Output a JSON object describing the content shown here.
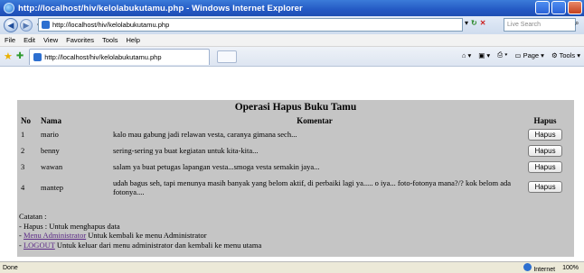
{
  "window": {
    "title": "http://localhost/hiv/kelolabukutamu.php - Windows Internet Explorer"
  },
  "address_bar": {
    "url": "http://localhost/hiv/kelolabukutamu.php",
    "search_placeholder": "Live Search"
  },
  "menu": [
    "File",
    "Edit",
    "View",
    "Favorites",
    "Tools",
    "Help"
  ],
  "tab": {
    "label": "http://localhost/hiv/kelolabukutamu.php"
  },
  "command_bar": {
    "page": "Page",
    "tools": "Tools"
  },
  "page": {
    "title": "Operasi Hapus Buku Tamu",
    "columns": {
      "no": "No",
      "nama": "Nama",
      "komentar": "Komentar",
      "hapus": "Hapus"
    },
    "rows": [
      {
        "no": "1",
        "nama": "mario",
        "komentar": "kalo mau gabung jadi relawan vesta, caranya gimana sech...",
        "action": "Hapus"
      },
      {
        "no": "2",
        "nama": "benny",
        "komentar": "sering-sering ya buat kegiatan untuk kita-kita...",
        "action": "Hapus"
      },
      {
        "no": "3",
        "nama": "wawan",
        "komentar": "salam ya buat petugas lapangan vesta...smoga vesta semakin jaya...",
        "action": "Hapus"
      },
      {
        "no": "4",
        "nama": "mantep",
        "komentar": "udah bagus seh, tapi menunya masih banyak yang belom aktif, di perbaiki lagi ya..... o iya... foto-fotonya mana?/? kok belom ada fotonya....",
        "action": "Hapus"
      }
    ],
    "notes": {
      "heading": "Catatan :",
      "hapus_line": "- Hapus : Untuk menghapus data",
      "menu_prefix": "- ",
      "menu_link": "Menu Administrator",
      "menu_text": " Untuk kembali ke menu Administrator",
      "logout_prefix": "- ",
      "logout_link": "LOGOUT",
      "logout_text": " Untuk keluar dari menu administrator dan kembali ke menu utama"
    }
  },
  "status_bar": {
    "left": "Done",
    "zone": "Internet",
    "zoom": "100%"
  }
}
